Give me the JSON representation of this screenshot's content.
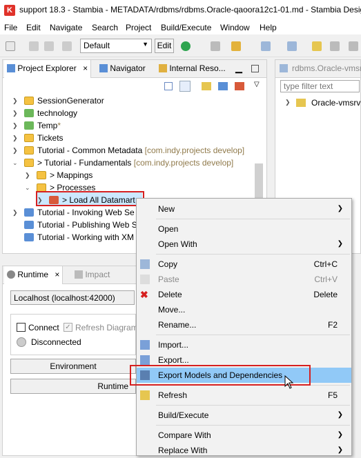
{
  "window": {
    "title": "support 18.3 - Stambia - METADATA/rdbms/rdbms.Oracle-qaoora12c1-01.md - Stambia Desig",
    "app_icon_glyph": "K"
  },
  "menubar": [
    "File",
    "Edit",
    "Navigate",
    "Search",
    "Project",
    "Build/Execute",
    "Window",
    "Help"
  ],
  "toolbar": {
    "perspective_value": "Default",
    "edit_label": "Edit"
  },
  "project_explorer": {
    "tabs": [
      {
        "label": "Project Explorer",
        "close": "×"
      },
      {
        "label": "Navigator"
      },
      {
        "label": "Internal Reso..."
      }
    ],
    "items": [
      {
        "label": "SessionGenerator",
        "decor": ""
      },
      {
        "label": "technology",
        "decor": ""
      },
      {
        "label": "Temp",
        "decor": "*"
      },
      {
        "label": "Tickets",
        "decor": ""
      },
      {
        "label": "Tutorial - Common Metadata",
        "decor": " [com.indy.projects develop]"
      },
      {
        "label": "> Tutorial - Fundamentals",
        "decor": " [com.indy.projects develop]"
      },
      {
        "label": "> Mappings",
        "decor": ""
      },
      {
        "label": "> Processes",
        "decor": ""
      },
      {
        "label": "> Load All Datamart",
        "decor": ""
      },
      {
        "label": "Tutorial - Invoking Web Se",
        "decor": ""
      },
      {
        "label": "Tutorial - Publishing Web S",
        "decor": ""
      },
      {
        "label": "Tutorial - Working with XM",
        "decor": ""
      }
    ]
  },
  "editor": {
    "tab_label": "rdbms.Oracle-vmsrv",
    "filter_placeholder": "type filter text",
    "tree_item": "Oracle-vmsrv"
  },
  "runtime": {
    "tabs": [
      {
        "label": "Runtime",
        "close": "×"
      },
      {
        "label": "Impact"
      }
    ],
    "server": "Localhost (localhost:42000)",
    "connect_label": "Connect",
    "refresh_label": "Refresh Diagram",
    "status": "Disconnected",
    "environment_btn": "Environment",
    "runtime_btn": "Runtime"
  },
  "context_menu": {
    "items": [
      {
        "label": "New",
        "accel": "",
        "submenu": true
      },
      {
        "label": "Open",
        "accel": ""
      },
      {
        "label": "Open With",
        "accel": "",
        "submenu": true
      },
      {
        "label": "Copy",
        "accel": "Ctrl+C"
      },
      {
        "label": "Paste",
        "accel": "Ctrl+V",
        "disabled": true
      },
      {
        "label": "Delete",
        "accel": "Delete"
      },
      {
        "label": "Move...",
        "accel": ""
      },
      {
        "label": "Rename...",
        "accel": "F2"
      },
      {
        "label": "Import...",
        "accel": ""
      },
      {
        "label": "Export...",
        "accel": ""
      },
      {
        "label": "Export Models and Dependencies",
        "accel": ""
      },
      {
        "label": "Refresh",
        "accel": "F5"
      },
      {
        "label": "Build/Execute",
        "accel": "",
        "submenu": true
      },
      {
        "label": "Compare With",
        "accel": "",
        "submenu": true
      },
      {
        "label": "Replace With",
        "accel": "",
        "submenu": true
      }
    ]
  },
  "colors": {
    "highlight_border": "#d62020",
    "menu_hover": "#91c9f7",
    "selection": "#cce8ff"
  }
}
